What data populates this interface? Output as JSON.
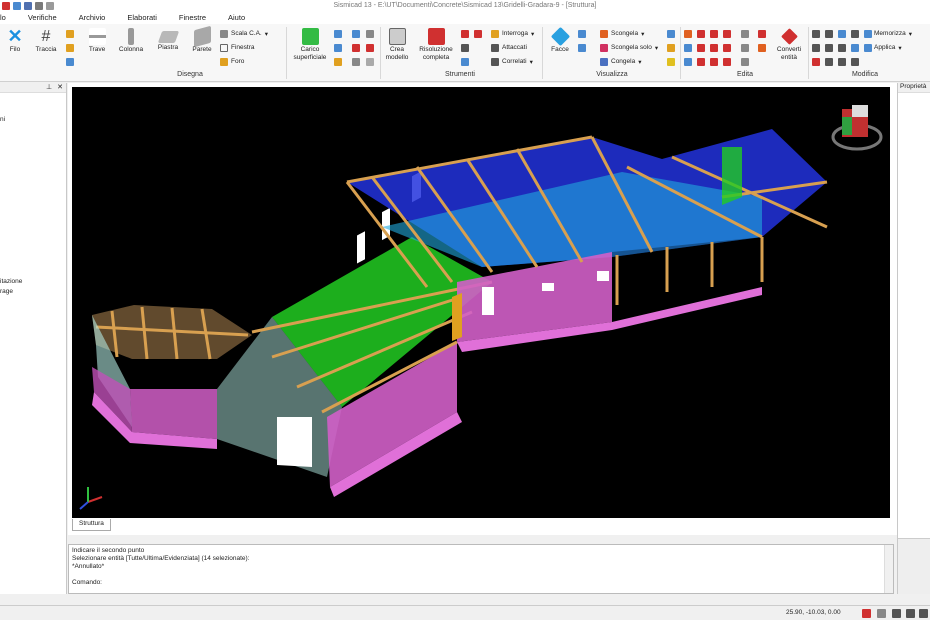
{
  "window": {
    "title": "Sismicad 13 - E:\\UT\\Documenti\\Concrete\\Sismicad 13\\Gridelli-Gradara-9 - [Struttura]"
  },
  "menu": [
    "lo",
    "Verifiche",
    "Archivio",
    "Elaborati",
    "Finestre",
    "Aiuto"
  ],
  "ribbon": {
    "filo": "Filo",
    "traccia": "Traccia",
    "trave": "Trave",
    "colonna": "Colonna",
    "piastra": "Piastra",
    "parete": "Parete",
    "scala_ca": "Scala C.A.",
    "finestra": "Finestra",
    "foro": "Foro",
    "carico_superficiale": "Carico superficiale",
    "crea_modello": "Crea modello",
    "risoluzione_completa": "Risoluzione completa",
    "interroga": "Interroga",
    "attaccati": "Attaccati",
    "correlati": "Correlati",
    "facce": "Facce",
    "scongela": "Scongela",
    "scongela_solo": "Scongela solo",
    "congela": "Congela",
    "converti_entita": "Converti entità",
    "memorizza": "Memorizza",
    "applica": "Applica",
    "groups": {
      "disegna": "Disegna",
      "strumenti": "Strumenti",
      "visualizza": "Visualizza",
      "edita": "Edita",
      "modifica": "Modifica"
    }
  },
  "left_panel": {
    "items": [
      "ni",
      "itazione",
      "rage"
    ]
  },
  "right_panel": {
    "title": "Proprietà"
  },
  "viewport": {
    "tab": "Struttura"
  },
  "command": {
    "lines": [
      "Indicare il secondo punto",
      "Selezionare entità [Tutte/Ultima/Evidenziata] (14 selezionate):",
      " *Annullato*",
      "",
      "Comando:"
    ]
  },
  "status": {
    "coords": "25.90, -10.03, 0.00"
  },
  "colors": {
    "wall": "#d25fc8",
    "slab_green": "#22cc22",
    "slab_blue": "#2233dd",
    "beam": "#c8903c",
    "glass": "#a0e0d8"
  }
}
